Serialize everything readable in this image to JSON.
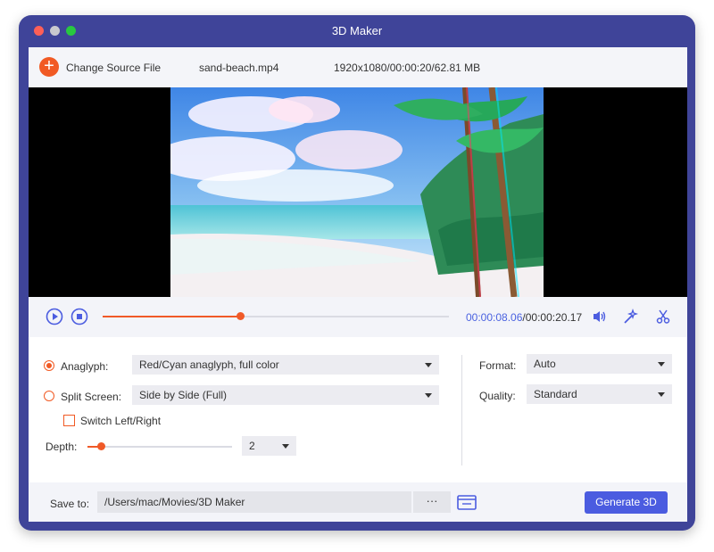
{
  "window": {
    "title": "3D Maker"
  },
  "source": {
    "change_label": "Change Source File",
    "filename": "sand-beach.mp4",
    "info": "1920x1080/00:00:20/62.81 MB"
  },
  "player": {
    "current_time": "00:00:08.06",
    "total_time": "/00:00:20.17",
    "progress_fraction": 0.4
  },
  "settings": {
    "anaglyph": {
      "label": "Anaglyph:",
      "value": "Red/Cyan anaglyph, full color",
      "checked": true
    },
    "split_screen": {
      "label": "Split Screen:",
      "value": "Side by Side (Full)",
      "checked": false
    },
    "switch_lr": {
      "label": "Switch Left/Right",
      "checked": false
    },
    "depth": {
      "label": "Depth:",
      "value": "2"
    },
    "format": {
      "label": "Format:",
      "value": "Auto"
    },
    "quality": {
      "label": "Quality:",
      "value": "Standard"
    }
  },
  "footer": {
    "save_label": "Save to:",
    "path": "/Users/mac/Movies/3D Maker",
    "browse": "···",
    "generate": "Generate 3D"
  },
  "colors": {
    "window_frame": "#3f4499",
    "accent_orange": "#f15a24",
    "accent_blue": "#4b5ce0"
  }
}
